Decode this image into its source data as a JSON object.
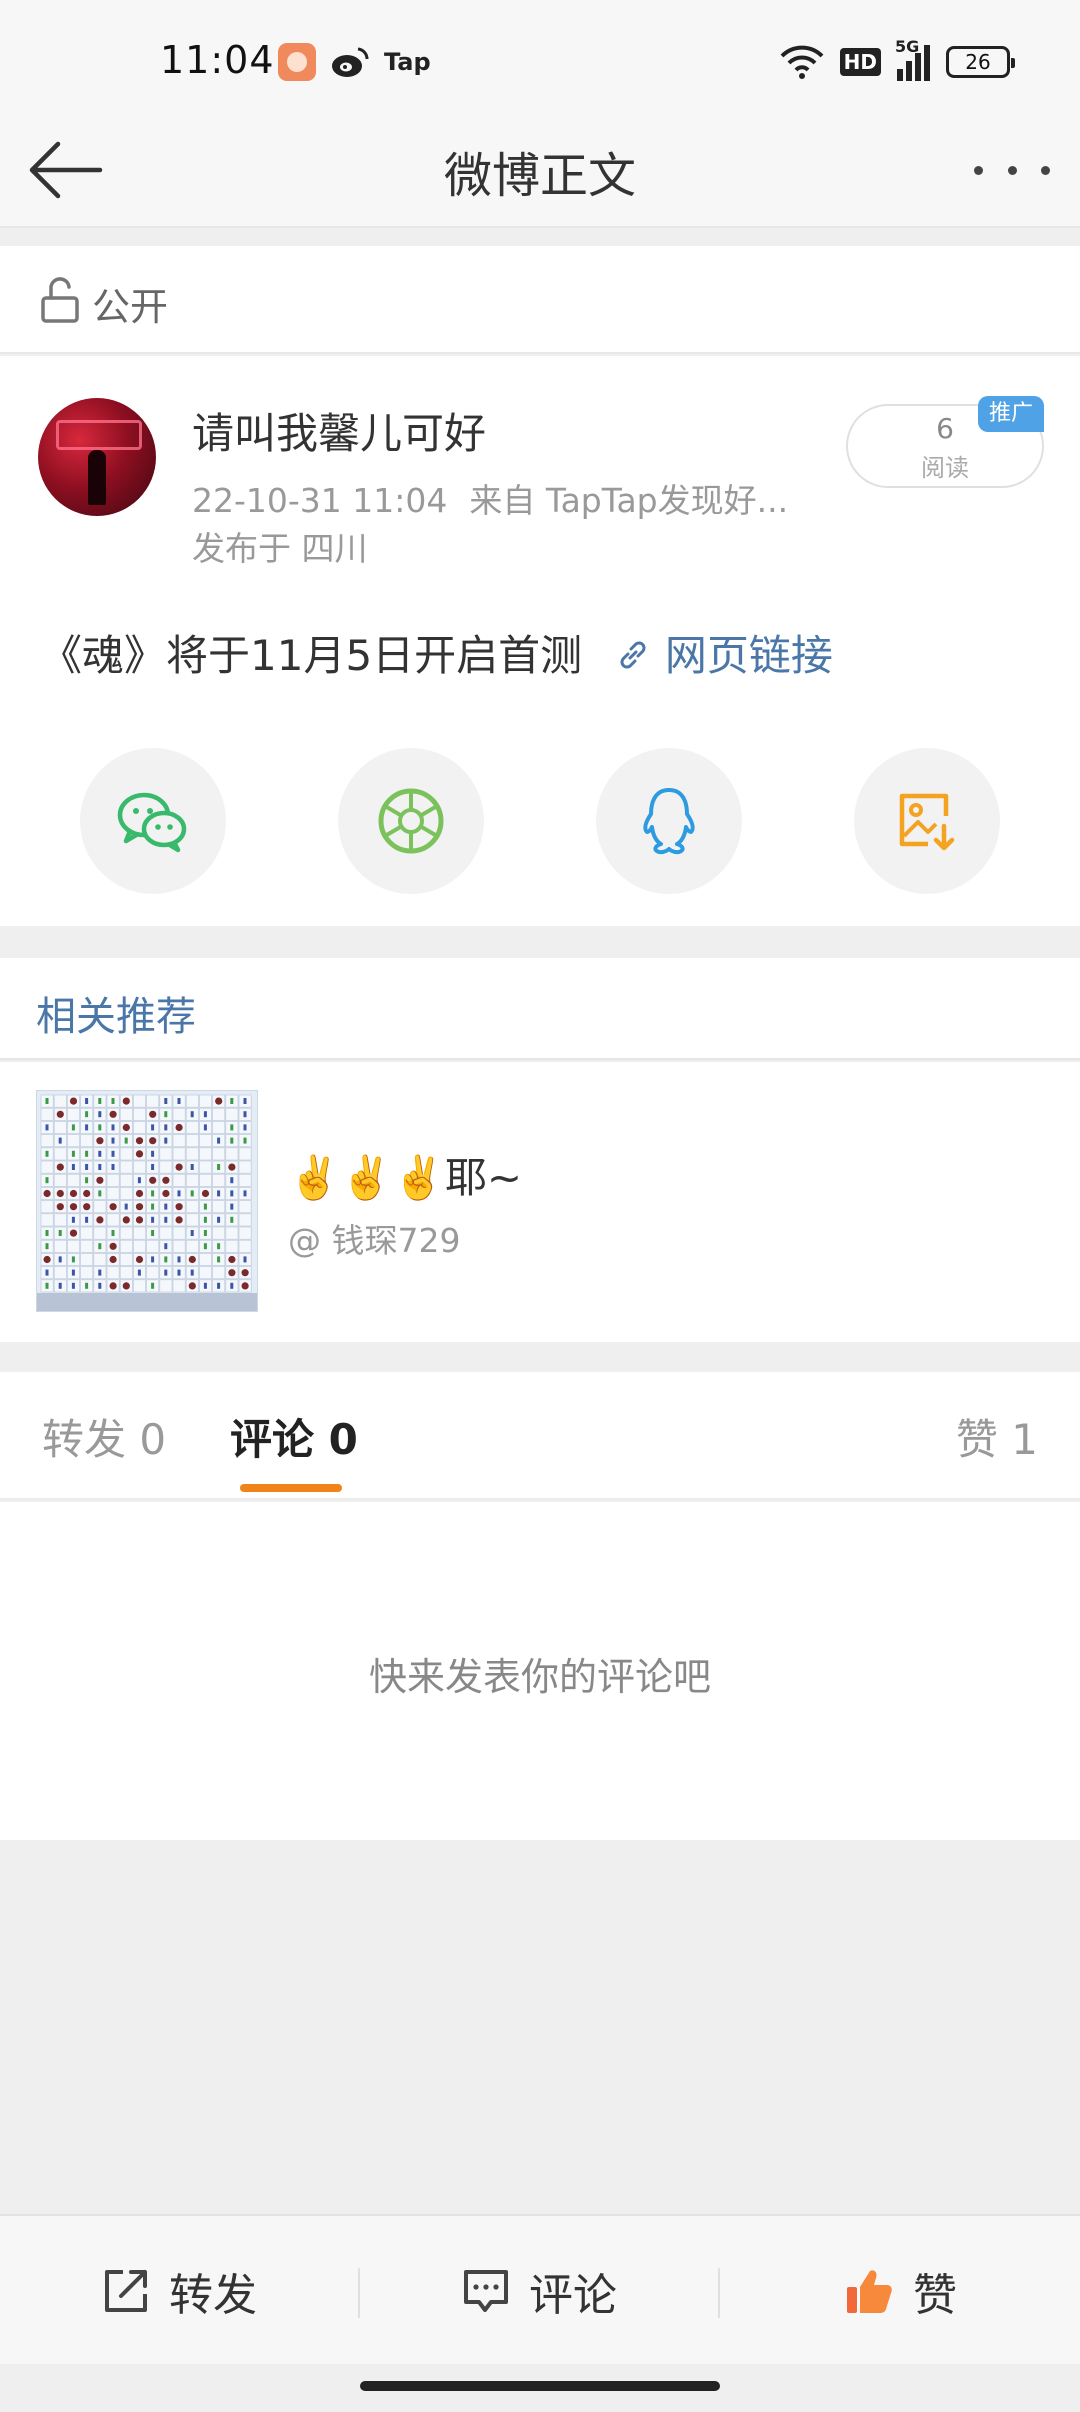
{
  "status_bar": {
    "time": "11:04",
    "tap_label": "Tap",
    "hd_label": "HD",
    "signal_label": "5G",
    "battery": "26"
  },
  "header": {
    "title": "微博正文"
  },
  "visibility": {
    "label": "公开"
  },
  "post": {
    "author": "请叫我馨儿可好",
    "datetime": "22-10-31 11:04",
    "source": "来自 TapTap发现好...",
    "location": "发布于 四川",
    "read_count": "6",
    "read_label": "阅读",
    "promo_tag": "推广",
    "text": "《魂》将于11月5日开启首测",
    "link_text": "网页链接"
  },
  "share": {
    "icons": [
      "wechat-icon",
      "moments-icon",
      "qq-icon",
      "save-image-icon"
    ],
    "colors": {
      "wechat": "#39b96b",
      "moments": "#7cc25c",
      "qq": "#2d9be0",
      "save": "#f4a321"
    }
  },
  "related": {
    "title": "相关推荐",
    "item": {
      "title": "✌️✌️✌️耶~",
      "author": "@ 钱琛729"
    }
  },
  "tabs": {
    "reposts": "转发 0",
    "comments": "评论 0",
    "likes": "赞 1"
  },
  "comments": {
    "empty_text": "快来发表你的评论吧"
  },
  "bottom_bar": {
    "repost": "转发",
    "comment": "评论",
    "like": "赞"
  },
  "colors": {
    "link": "#4a77a8",
    "accent": "#f08418",
    "promo": "#4ea2e5"
  }
}
